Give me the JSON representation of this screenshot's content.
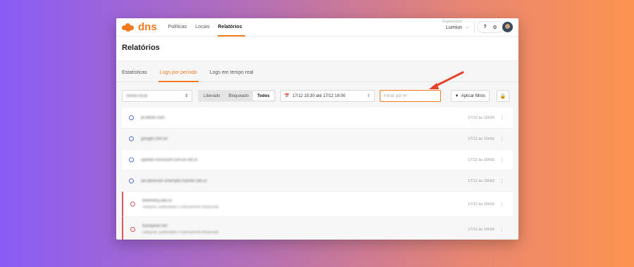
{
  "brand": {
    "name": "dns",
    "color": "#f27a21"
  },
  "nav": {
    "links": [
      "Políticas",
      "Locais",
      "Relatórios"
    ],
    "active_index": 2
  },
  "org": {
    "label": "Organização",
    "value": "Lumiun"
  },
  "header_icons": {
    "help": "?",
    "settings": "gear-icon"
  },
  "page": {
    "title": "Relatórios"
  },
  "tabs": {
    "items": [
      "Estatísticas",
      "Logs por período",
      "Logs em tempo real"
    ],
    "active_index": 1
  },
  "toolbar": {
    "device_select": "clmeo.local",
    "status_segments": [
      "Liberado",
      "Bloqueado",
      "Todos"
    ],
    "status_active_index": 2,
    "date_range": "17/12 15:30 até 17/12 16:00",
    "ip_placeholder": "Filtrar por IP",
    "apply_filters": "Aplicar filtros",
    "export_icon": "lock-icon"
  },
  "logs": [
    {
      "domain": "pt.tiktok.com",
      "sub": "",
      "time": "17/12 às 15h59",
      "blocked": false
    },
    {
      "domain": "google.com.br",
      "sub": "",
      "time": "17/12 às 15h59",
      "blocked": false
    },
    {
      "domain": "update.microsoft.com.br.net.io",
      "sub": "",
      "time": "17/12 às 15h59",
      "blocked": false
    },
    {
      "domain": "ad.adserver-example.tracker.cdn.io",
      "sub": "",
      "time": "17/12 às 15h59",
      "blocked": false
    },
    {
      "domain": "telemetry.ads.io",
      "sub": "categoria: publicidade e rastreamento bloqueada",
      "time": "17/12 às 15h59",
      "blocked": true
    },
    {
      "domain": "trackpixel.net",
      "sub": "categoria: publicidade e rastreamento bloqueada",
      "time": "17/12 às 15h59",
      "blocked": true
    }
  ],
  "colors": {
    "accent": "#f27a21",
    "blocked": "#e05656",
    "allowed_icon": "#5a6fd6"
  }
}
